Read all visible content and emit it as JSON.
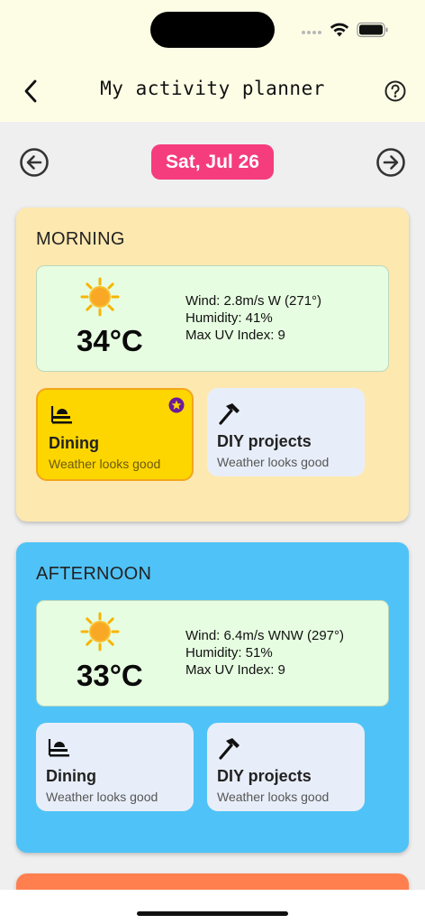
{
  "header": {
    "title": "My activity planner",
    "back_icon": "chevron-left-icon",
    "help_icon": "help-circle-icon"
  },
  "date_nav": {
    "date_label": "Sat, Jul 26",
    "prev_icon": "arrow-left-circle-icon",
    "next_icon": "arrow-right-circle-icon",
    "pill_color": "#f53c7c"
  },
  "periods": [
    {
      "title": "MORNING",
      "bg_color": "#fde8b0",
      "weather": {
        "icon": "sun-icon",
        "temperature": "34°C",
        "wind": "Wind: 2.8m/s W (271°)",
        "humidity": "Humidity: 41%",
        "uv": "Max UV Index: 9"
      },
      "activities": [
        {
          "name": "Dining",
          "note": "Weather looks good",
          "icon": "dining-icon",
          "starred": true
        },
        {
          "name": "DIY projects",
          "note": "Weather looks good",
          "icon": "hammer-icon",
          "starred": false
        }
      ]
    },
    {
      "title": "AFTERNOON",
      "bg_color": "#4fc3f7",
      "weather": {
        "icon": "sun-icon",
        "temperature": "33°C",
        "wind": "Wind: 6.4m/s WNW (297°)",
        "humidity": "Humidity: 51%",
        "uv": "Max UV Index: 9"
      },
      "activities": [
        {
          "name": "Dining",
          "note": "Weather looks good",
          "icon": "dining-icon",
          "starred": false
        },
        {
          "name": "DIY projects",
          "note": "Weather looks good",
          "icon": "hammer-icon",
          "starred": false
        }
      ]
    },
    {
      "title": "",
      "bg_color": "#ff7f4f"
    }
  ],
  "colors": {
    "header_bg": "#fdfde6",
    "page_bg": "#efefef",
    "weather_box_bg": "#e6fde1",
    "activity_bg": "#e8eef9",
    "starred_bg": "#fdd600",
    "star_badge": "#6a1b9a"
  }
}
